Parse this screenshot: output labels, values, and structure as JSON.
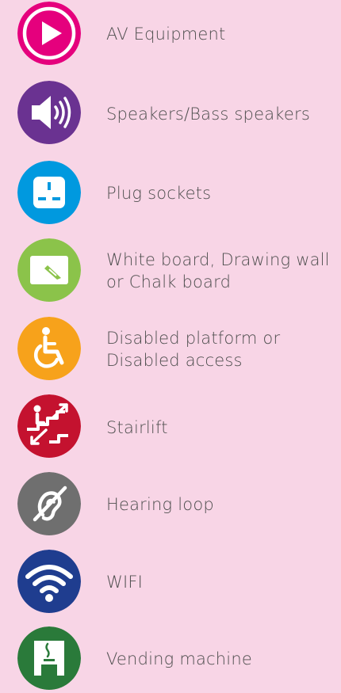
{
  "items": [
    {
      "label": "AV Equipment",
      "icon": "play-icon",
      "color": "#e5007d"
    },
    {
      "label": "Speakers/Bass speakers",
      "icon": "speaker-icon",
      "color": "#6a3291"
    },
    {
      "label": "Plug sockets",
      "icon": "plug-socket-icon",
      "color": "#0099df"
    },
    {
      "label": "White board, Drawing wall or Chalk board",
      "icon": "whiteboard-icon",
      "color": "#8bc34a"
    },
    {
      "label": "Disabled platform or Disabled access",
      "icon": "wheelchair-icon",
      "color": "#f7a21b"
    },
    {
      "label": "Stairlift",
      "icon": "stairlift-icon",
      "color": "#c4122f"
    },
    {
      "label": "Hearing loop",
      "icon": "hearing-loop-icon",
      "color": "#6f6f6f"
    },
    {
      "label": "WIFI",
      "icon": "wifi-icon",
      "color": "#1f3d8f"
    },
    {
      "label": "Vending machine",
      "icon": "vending-machine-icon",
      "color": "#2a7a3a"
    }
  ]
}
